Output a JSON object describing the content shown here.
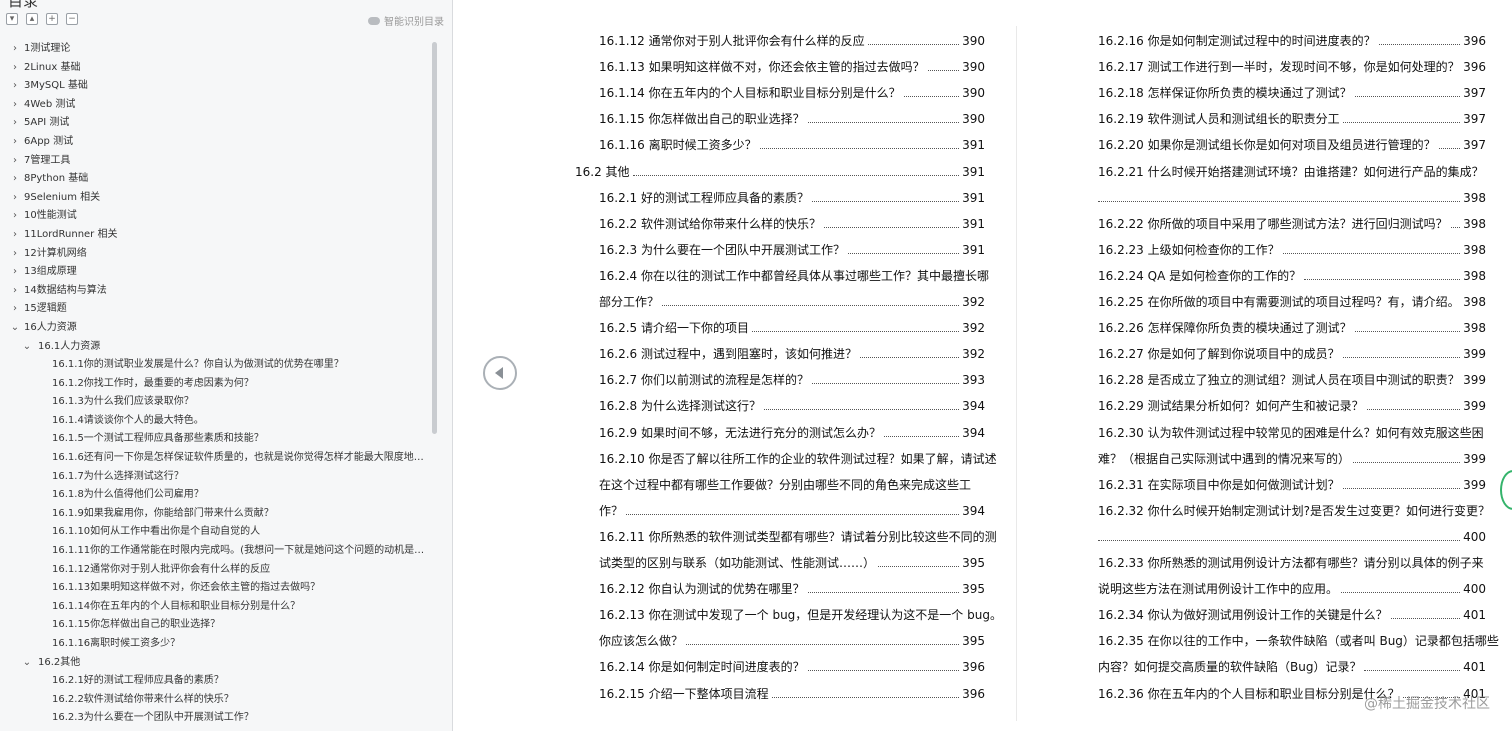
{
  "sidebar": {
    "title": "目录",
    "smart_toc": "智能识别目录",
    "items": [
      {
        "level": 0,
        "expanded": false,
        "label": "1测试理论"
      },
      {
        "level": 0,
        "expanded": false,
        "label": "2Linux 基础"
      },
      {
        "level": 0,
        "expanded": false,
        "label": "3MySQL 基础"
      },
      {
        "level": 0,
        "expanded": false,
        "label": "4Web 测试"
      },
      {
        "level": 0,
        "expanded": false,
        "label": "5API 测试"
      },
      {
        "level": 0,
        "expanded": false,
        "label": "6App 测试"
      },
      {
        "level": 0,
        "expanded": false,
        "label": "7管理工具"
      },
      {
        "level": 0,
        "expanded": false,
        "label": "8Python 基础"
      },
      {
        "level": 0,
        "expanded": false,
        "label": "9Selenium 相关"
      },
      {
        "level": 0,
        "expanded": false,
        "label": "10性能测试"
      },
      {
        "level": 0,
        "expanded": false,
        "label": "11LordRunner 相关"
      },
      {
        "level": 0,
        "expanded": false,
        "label": "12计算机网络"
      },
      {
        "level": 0,
        "expanded": false,
        "label": "13组成原理"
      },
      {
        "level": 0,
        "expanded": false,
        "label": "14数据结构与算法"
      },
      {
        "level": 0,
        "expanded": false,
        "label": "15逻辑题"
      },
      {
        "level": 0,
        "expanded": true,
        "label": "16人力资源"
      },
      {
        "level": 1,
        "expanded": true,
        "label": "16.1人力资源"
      },
      {
        "level": 2,
        "label": "16.1.1你的测试职业发展是什么？你自认为做测试的优势在哪里？"
      },
      {
        "level": 2,
        "label": "16.1.2你找工作时，最重要的考虑因素为何？"
      },
      {
        "level": 2,
        "label": "16.1.3为什么我们应该录取你？"
      },
      {
        "level": 2,
        "label": "16.1.4请谈谈你个人的最大特色。"
      },
      {
        "level": 2,
        "label": "16.1.5一个测试工程师应具备那些素质和技能？"
      },
      {
        "level": 2,
        "label": "16.1.6还有问一下你是怎样保证软件质量的，也就是说你觉得怎样才能最大限度地…"
      },
      {
        "level": 2,
        "label": "16.1.7为什么选择测试这行？"
      },
      {
        "level": 2,
        "label": "16.1.8为什么值得他们公司雇用？"
      },
      {
        "level": 2,
        "label": "16.1.9如果我雇用你，你能给部门带来什么贡献？"
      },
      {
        "level": 2,
        "label": "16.1.10如何从工作中看出你是个自动自觉的人"
      },
      {
        "level": 2,
        "label": "16.1.11你的工作通常能在时限内完成吗。(我想问一下就是她问这个问题的动机是…"
      },
      {
        "level": 2,
        "label": "16.1.12通常你对于别人批评你会有什么样的反应"
      },
      {
        "level": 2,
        "label": "16.1.13如果明知这样做不对，你还会依主管的指过去做吗？"
      },
      {
        "level": 2,
        "label": "16.1.14你在五年内的个人目标和职业目标分别是什么？"
      },
      {
        "level": 2,
        "label": "16.1.15你怎样做出自己的职业选择？"
      },
      {
        "level": 2,
        "label": "16.1.16离职时候工资多少？"
      },
      {
        "level": 1,
        "expanded": true,
        "label": "16.2其他"
      },
      {
        "level": 2,
        "label": "16.2.1好的测试工程师应具备的素质？"
      },
      {
        "level": 2,
        "label": "16.2.2软件测试给你带来什么样的快乐？"
      },
      {
        "level": 2,
        "label": "16.2.3为什么要在一个团队中开展测试工作？"
      }
    ]
  },
  "pages": {
    "left": [
      {
        "num": "16.1.12",
        "text": "通常你对于别人批评你会有什么样的反应",
        "page": "390",
        "indent": 1
      },
      {
        "num": "16.1.13",
        "text": "如果明知这样做不对，你还会依主管的指过去做吗？",
        "page": "390",
        "indent": 1
      },
      {
        "num": "16.1.14",
        "text": "你在五年内的个人目标和职业目标分别是什么？",
        "page": "390",
        "indent": 1
      },
      {
        "num": "16.1.15",
        "text": "你怎样做出自己的职业选择？",
        "page": "390",
        "indent": 1
      },
      {
        "num": "16.1.16",
        "text": "离职时候工资多少？",
        "page": "391",
        "indent": 1
      },
      {
        "num": "16.2",
        "text": "其他",
        "page": "391",
        "indent": 0
      },
      {
        "num": "16.2.1",
        "text": "好的测试工程师应具备的素质？",
        "page": "391",
        "indent": 1
      },
      {
        "num": "16.2.2",
        "text": "软件测试给你带来什么样的快乐？",
        "page": "391",
        "indent": 1
      },
      {
        "num": "16.2.3",
        "text": "为什么要在一个团队中开展测试工作？",
        "page": "391",
        "indent": 1
      },
      {
        "num": "16.2.4",
        "text": "你在以往的测试工作中都曾经具体从事过哪些工作？其中最擅长哪",
        "indent": 1,
        "page": ""
      },
      {
        "num": "",
        "text": "部分工作？",
        "page": "392",
        "indent": 1
      },
      {
        "num": "16.2.5",
        "text": "请介绍一下你的项目",
        "page": "392",
        "indent": 1
      },
      {
        "num": "16.2.6",
        "text": "测试过程中，遇到阻塞时，该如何推进？",
        "page": "392",
        "indent": 1
      },
      {
        "num": "16.2.7",
        "text": "你们以前测试的流程是怎样的？",
        "page": "393",
        "indent": 1
      },
      {
        "num": "16.2.8",
        "text": "为什么选择测试这行？",
        "page": "394",
        "indent": 1
      },
      {
        "num": "16.2.9",
        "text": "如果时间不够，无法进行充分的测试怎么办？",
        "page": "394",
        "indent": 1
      },
      {
        "num": "16.2.10",
        "text": "你是否了解以往所工作的企业的软件测试过程？如果了解，请试述",
        "page": "",
        "indent": 1
      },
      {
        "num": "",
        "text": "在这个过程中都有哪些工作要做？分别由哪些不同的角色来完成这些工",
        "page": "",
        "indent": 1
      },
      {
        "num": "",
        "text": "作？",
        "page": "394",
        "indent": 1
      },
      {
        "num": "16.2.11",
        "text": "你所熟悉的软件测试类型都有哪些？请试着分别比较这些不同的测",
        "page": "",
        "indent": 1
      },
      {
        "num": "",
        "text": "试类型的区别与联系（如功能测试、性能测试……）",
        "page": "395",
        "indent": 1
      },
      {
        "num": "16.2.12",
        "text": "你自认为测试的优势在哪里？",
        "page": "395",
        "indent": 1
      },
      {
        "num": "16.2.13",
        "text": "你在测试中发现了一个 bug，但是开发经理认为这不是一个 bug。",
        "page": "",
        "indent": 1
      },
      {
        "num": "",
        "text": "你应该怎么做？",
        "page": "395",
        "indent": 1
      },
      {
        "num": "16.2.14",
        "text": "你是如何制定时间进度表的？",
        "page": "396",
        "indent": 1
      },
      {
        "num": "16.2.15",
        "text": "介绍一下整体项目流程",
        "page": "396",
        "indent": 1
      }
    ],
    "right": [
      {
        "num": "16.2.16",
        "text": "你是如何制定测试过程中的时间进度表的？",
        "page": "396"
      },
      {
        "num": "16.2.17",
        "text": "测试工作进行到一半时，发现时间不够，你是如何处理的？",
        "page": "396"
      },
      {
        "num": "16.2.18",
        "text": "怎样保证你所负责的模块通过了测试？",
        "page": "397"
      },
      {
        "num": "16.2.19",
        "text": "软件测试人员和测试组长的职责分工",
        "page": "397"
      },
      {
        "num": "16.2.20",
        "text": "如果你是测试组长你是如何对项目及组员进行管理的？",
        "page": "397"
      },
      {
        "num": "16.2.21",
        "text": "什么时候开始搭建测试环境？由谁搭建？如何进行产品的集成？",
        "page": ""
      },
      {
        "num": "",
        "text": "",
        "page": "398"
      },
      {
        "num": "16.2.22",
        "text": "你所做的项目中采用了哪些测试方法？进行回归测试吗？",
        "page": "398"
      },
      {
        "num": "16.2.23",
        "text": "上级如何检查你的工作？",
        "page": "398"
      },
      {
        "num": "16.2.24",
        "text": "QA 是如何检查你的工作的？",
        "page": "398"
      },
      {
        "num": "16.2.25",
        "text": "在你所做的项目中有需要测试的项目过程吗？有，请介绍。",
        "page": "398"
      },
      {
        "num": "16.2.26",
        "text": "怎样保障你所负责的模块通过了测试？",
        "page": "398"
      },
      {
        "num": "16.2.27",
        "text": "你是如何了解到你说项目中的成员？",
        "page": "399"
      },
      {
        "num": "16.2.28",
        "text": "是否成立了独立的测试组？测试人员在项目中测试的职责？",
        "page": "399"
      },
      {
        "num": "16.2.29",
        "text": "测试结果分析如何？如何产生和被记录？",
        "page": "399"
      },
      {
        "num": "16.2.30",
        "text": "认为软件测试过程中较常见的困难是什么？如何有效克服这些困",
        "page": ""
      },
      {
        "num": "",
        "text": "难？（根据自己实际测试中遇到的情况来写的）",
        "page": "399"
      },
      {
        "num": "16.2.31",
        "text": "在实际项目中你是如何做测试计划？",
        "page": "399"
      },
      {
        "num": "16.2.32",
        "text": "你什么时候开始制定测试计划?是否发生过变更？如何进行变更？",
        "page": ""
      },
      {
        "num": "",
        "text": "",
        "page": "400"
      },
      {
        "num": "16.2.33",
        "text": "你所熟悉的测试用例设计方法都有哪些？请分别以具体的例子来",
        "page": ""
      },
      {
        "num": "",
        "text": "说明这些方法在测试用例设计工作中的应用。",
        "page": "400"
      },
      {
        "num": "16.2.34",
        "text": "你认为做好测试用例设计工作的关键是什么？",
        "page": "401"
      },
      {
        "num": "16.2.35",
        "text": "在你以往的工作中，一条软件缺陷（或者叫 Bug）记录都包括哪些",
        "page": ""
      },
      {
        "num": "",
        "text": "内容？如何提交高质量的软件缺陷（Bug）记录？",
        "page": "401"
      },
      {
        "num": "16.2.36",
        "text": "你在五年内的个人目标和职业目标分别是什么？",
        "page": "401"
      }
    ]
  },
  "watermark": "@稀土掘金技术社区",
  "colors": {
    "sidebar_bg": "#f6f7f8",
    "accent": "#34b36b"
  }
}
